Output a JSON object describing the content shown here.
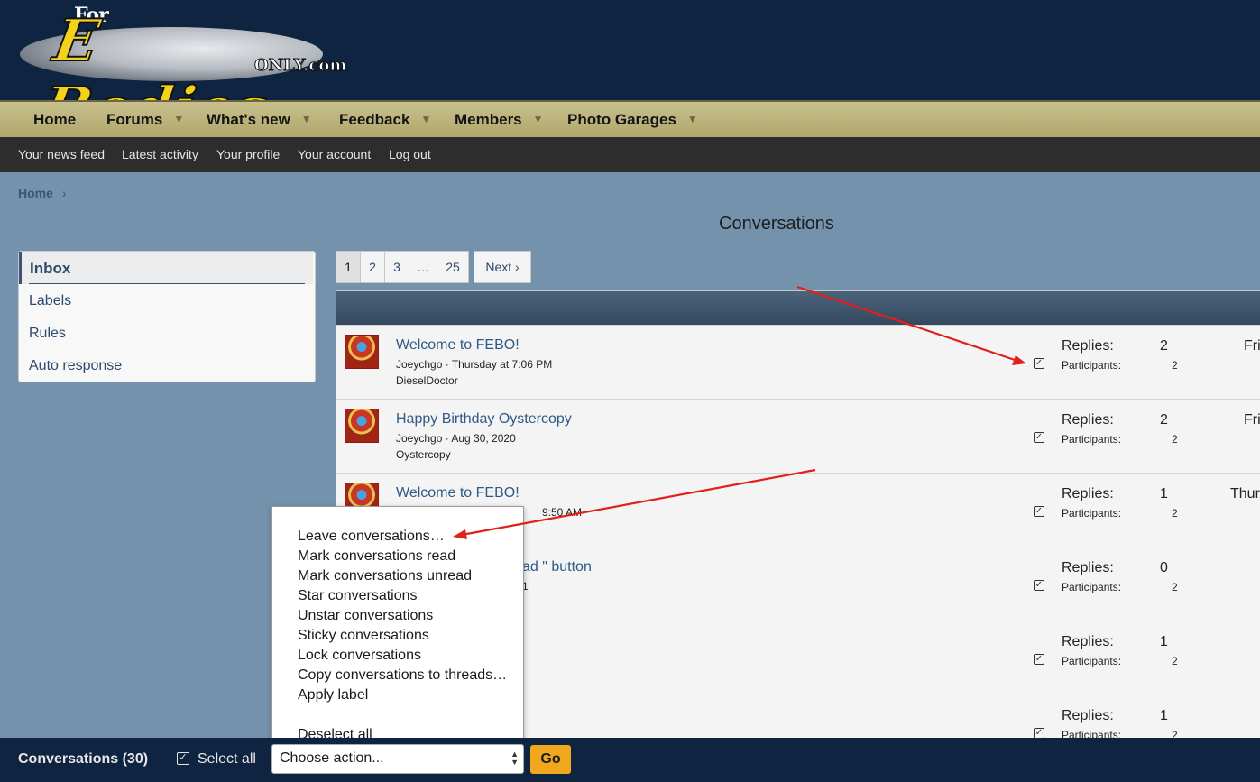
{
  "site": {
    "logo_text_for": "For",
    "logo_text_main": "E Bodies",
    "logo_text_only": "ONLY.com"
  },
  "nav": {
    "items": [
      {
        "label": "Home",
        "has_menu": false
      },
      {
        "label": "Forums",
        "has_menu": true
      },
      {
        "label": "What's new",
        "has_menu": true
      },
      {
        "label": "Feedback",
        "has_menu": true
      },
      {
        "label": "Members",
        "has_menu": true
      },
      {
        "label": "Photo Garages",
        "has_menu": true
      }
    ]
  },
  "subnav": {
    "items": [
      "Your news feed",
      "Latest activity",
      "Your profile",
      "Your account",
      "Log out"
    ]
  },
  "breadcrumb": {
    "home": "Home",
    "separator": "›"
  },
  "page_title": "Conversations",
  "sidebar": {
    "active": "Inbox",
    "items": [
      "Labels",
      "Rules",
      "Auto response"
    ]
  },
  "pagination": {
    "pages": [
      "1",
      "2",
      "3",
      "…",
      "25"
    ],
    "current": "1",
    "next_label": "Next ›"
  },
  "conversations": [
    {
      "title": "Welcome to FEBO!",
      "meta": "Joeychgo · Thursday at 7:06 PM",
      "participants_names": "DieselDoctor",
      "replies_label": "Replies:",
      "replies": "2",
      "participants_label": "Participants:",
      "participants": "2",
      "date": "Fri"
    },
    {
      "title": "Happy Birthday Oystercopy",
      "meta": "Joeychgo · Aug 30, 2020",
      "participants_names": "Oystercopy",
      "replies_label": "Replies:",
      "replies": "2",
      "participants_label": "Participants:",
      "participants": "2",
      "date": "Fri"
    },
    {
      "title": "Welcome to FEBO!",
      "meta": "9:50 AM",
      "participants_names": "",
      "replies_label": "Replies:",
      "replies": "1",
      "participants_label": "Participants:",
      "participants": "2",
      "date": "Thur"
    },
    {
      "title": "ad \" button",
      "meta": "1",
      "participants_names": "",
      "replies_label": "Replies:",
      "replies": "0",
      "participants_label": "Participants:",
      "participants": "2",
      "date": ""
    },
    {
      "title": "",
      "meta": "",
      "participants_names": "",
      "replies_label": "Replies:",
      "replies": "1",
      "participants_label": "Participants:",
      "participants": "2",
      "date": ""
    },
    {
      "title": "",
      "meta": "",
      "participants_names": "",
      "replies_label": "Replies:",
      "replies": "1",
      "participants_label": "Participants:",
      "participants": "2",
      "date": ""
    }
  ],
  "action_menu": {
    "items": [
      "Leave conversations…",
      "Mark conversations read",
      "Mark conversations unread",
      "Star conversations",
      "Unstar conversations",
      "Sticky conversations",
      "Lock conversations",
      "Copy conversations to threads…",
      "Apply label",
      "Deselect all"
    ]
  },
  "footer": {
    "title": "Conversations (30)",
    "select_all": "Select all",
    "select_all_checked": true,
    "action_select_value": "Choose action...",
    "go_label": "Go"
  },
  "colors": {
    "header_bg": "#0f2440",
    "nav_bg": "#c8c08d",
    "subnav_bg": "#2d2d2d",
    "page_bg": "#7592ad",
    "link": "#2f5a85",
    "go_button": "#f2a81d",
    "annotation_arrow": "#e0201a"
  }
}
